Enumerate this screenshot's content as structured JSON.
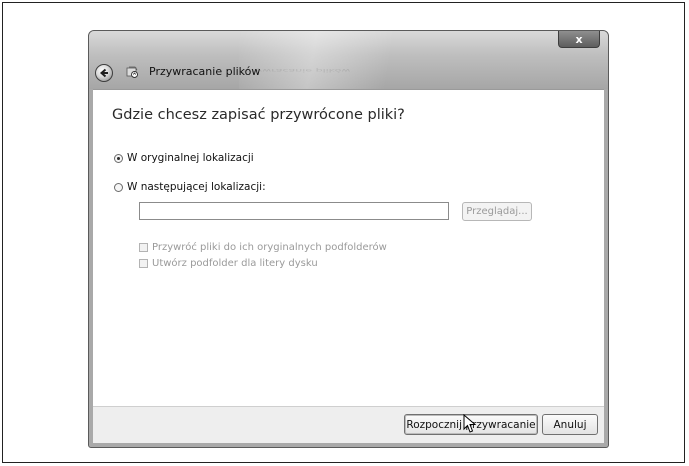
{
  "window": {
    "title": "Przywracanie plików",
    "close_label": "x"
  },
  "content": {
    "heading": "Gdzie chcesz zapisać przywrócone pliki?",
    "options": [
      {
        "label": "W oryginalnej lokalizacji",
        "selected": true
      },
      {
        "label": "W następującej lokalizacji:",
        "selected": false
      }
    ],
    "path_input": {
      "value": "",
      "placeholder": ""
    },
    "browse_label": "Przeglądaj...",
    "checkboxes": [
      {
        "label": "Przywróć pliki do ich oryginalnych podfolderów",
        "checked": false,
        "enabled": false
      },
      {
        "label": "Utwórz podfolder dla litery dysku",
        "checked": false,
        "enabled": false
      }
    ]
  },
  "footer": {
    "start_label": "Rozpocznij przywracanie",
    "cancel_label": "Anuluj"
  }
}
